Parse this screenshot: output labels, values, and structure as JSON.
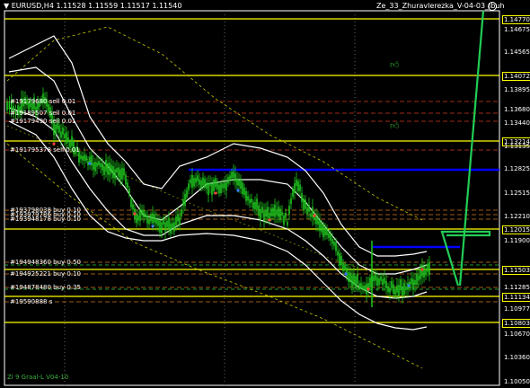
{
  "header": {
    "symbol_info": "▼ EURUSD,H4  1.11528 1.11559 1.11517 1.11540",
    "indicator_name": "Ze_33_Zhuravlerezka_V-04-03_Ibuh",
    "indicator_icon": "smiley-icon"
  },
  "price_scale": [
    {
      "value": "1.14770",
      "highlight": true
    },
    {
      "value": "1.14675",
      "highlight": false
    },
    {
      "value": "1.14565",
      "highlight": false
    },
    {
      "value": "1.14072",
      "highlight": true
    },
    {
      "value": "1.13895",
      "highlight": false
    },
    {
      "value": "1.13680",
      "highlight": false
    },
    {
      "value": "1.13440",
      "highlight": false
    },
    {
      "value": "1.13214",
      "highlight": true
    },
    {
      "value": "1.13135",
      "highlight": false
    },
    {
      "value": "1.12825",
      "highlight": false
    },
    {
      "value": "1.12515",
      "highlight": false
    },
    {
      "value": "1.12210",
      "highlight": false
    },
    {
      "value": "1.12015",
      "highlight": true
    },
    {
      "value": "1.11900",
      "highlight": false
    },
    {
      "value": "1.11503",
      "highlight": true
    },
    {
      "value": "1.11285",
      "highlight": false
    },
    {
      "value": "1.11134",
      "highlight": true
    },
    {
      "value": "1.10977",
      "highlight": false
    },
    {
      "value": "1.10803",
      "highlight": true
    },
    {
      "value": "1.10670",
      "highlight": false
    },
    {
      "value": "1.10360",
      "highlight": false
    },
    {
      "value": "1.10050",
      "highlight": false
    }
  ],
  "order_labels": [
    "#19179680 sell 0.01",
    "#19189507 sell 0.01",
    "#19179490 sell 0.01",
    "#191795378 sell 0.01",
    "#193798038 buy 0.10",
    "#193979786 buy 0.10",
    "#193948178 buy 0.10",
    "#194948360 buy 0.50",
    "#194925221 buy 0.10",
    "#194878480 buy 0.35",
    "#19590888 s"
  ],
  "footer": {
    "text": "Zi 9 Graal-L V04-10"
  },
  "colors": {
    "background": "#000000",
    "candle": "#1ec81e",
    "level_line": "#ffff00",
    "blue_line": "#0000ff",
    "green_projection": "#22cc55",
    "bands": "#ffffff",
    "outer_band": "#c8c800"
  },
  "icons": [
    "thumbs-up-icon",
    "thumbs-up-icon",
    "smiley-icon"
  ]
}
